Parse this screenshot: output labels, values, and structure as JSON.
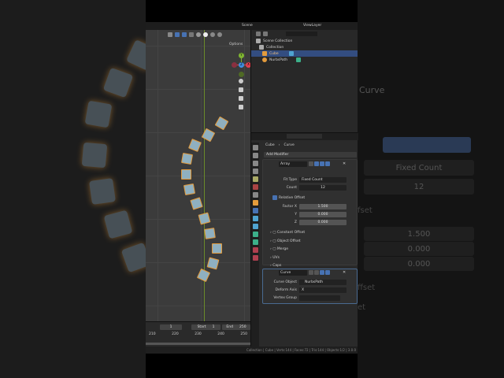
{
  "header": {
    "scene": "Scene",
    "view_layer": "ViewLayer"
  },
  "viewport": {
    "options_label": "Options",
    "gizmo": {
      "x": "X",
      "y": "Y",
      "z": "Z"
    }
  },
  "outliner": {
    "items": [
      {
        "label": "Scene Collection"
      },
      {
        "label": "Collection"
      },
      {
        "label": "Cube",
        "selected": true
      },
      {
        "label": "NurbsPath"
      }
    ]
  },
  "properties": {
    "breadcrumb": {
      "object": "Cube",
      "data": "Curve"
    },
    "add_modifier": "Add Modifier",
    "array": {
      "name": "Array",
      "fit_type_label": "Fit Type",
      "fit_type": "Fixed Count",
      "count_label": "Count",
      "count": "12",
      "relative_offset_label": "Relative Offset",
      "relative_offset_checked": true,
      "factor_labels": [
        "Factor X",
        "Y",
        "Z"
      ],
      "factors": [
        "1.500",
        "0.000",
        "0.000"
      ],
      "subpanels": [
        "Constant Offset",
        "Object Offset",
        "Merge",
        "UVs",
        "Caps"
      ]
    },
    "curve": {
      "name": "Curve",
      "curve_object_label": "Curve Object",
      "curve_object": "NurbsPath",
      "deform_axis_label": "Deform Axis",
      "deform_axis": "X",
      "vertex_group_label": "Vertex Group",
      "vertex_group": ""
    }
  },
  "timeline": {
    "current_frame": "1",
    "start_label": "Start",
    "start": "1",
    "end_label": "End",
    "end": "250",
    "ticks": [
      "210",
      "220",
      "230",
      "240",
      "250"
    ]
  },
  "status_bar": "Collection | Cube | Verts:144 | Faces:72 | Tris:144 | Objects:1/2 | 3.0.0",
  "right_mirror": {
    "title": "Curve",
    "fit_type": "Fixed Count",
    "count": "12",
    "factors": [
      "1.500",
      "0.000",
      "0.000"
    ],
    "frag1": "fset",
    "frag2": "ffset",
    "frag3": "et"
  },
  "colors": {
    "selection": "#334d80",
    "accent": "#4772b3",
    "x_axis": "#e0404f",
    "y_axis": "#7fb532",
    "z_axis": "#3f8fe0",
    "object_outline": "#e39b3c"
  }
}
